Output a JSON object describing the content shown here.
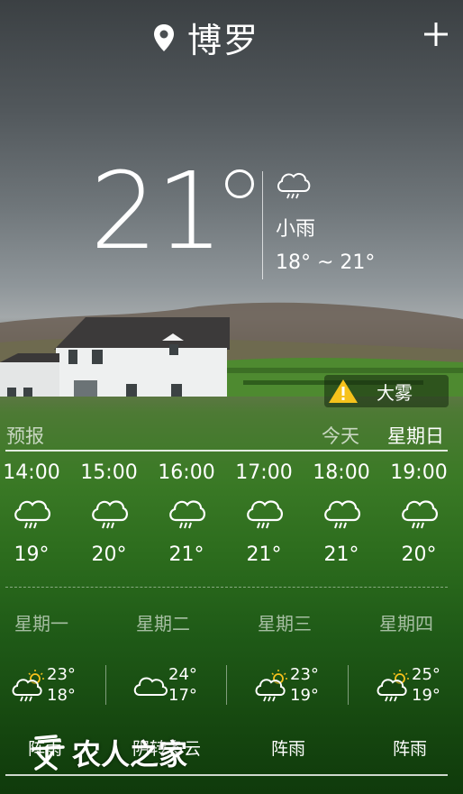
{
  "header": {
    "city": "博罗",
    "location_icon": "location-pin-icon",
    "add_icon": "plus-icon"
  },
  "current": {
    "temperature": "21",
    "condition": "小雨",
    "range": "18° ~ 21°",
    "icon": "light-rain-icon"
  },
  "alert": {
    "icon": "warning-icon",
    "label": "大雾"
  },
  "forecast": {
    "label": "预报",
    "tabs": [
      {
        "label": "今天",
        "active": false
      },
      {
        "label": "星期日",
        "active": true
      }
    ]
  },
  "hourly": [
    {
      "time": "14:00",
      "temp": "19°",
      "icon": "rain-icon"
    },
    {
      "time": "15:00",
      "temp": "20°",
      "icon": "rain-icon"
    },
    {
      "time": "16:00",
      "temp": "21°",
      "icon": "rain-icon"
    },
    {
      "time": "17:00",
      "temp": "21°",
      "icon": "rain-icon"
    },
    {
      "time": "18:00",
      "temp": "21°",
      "icon": "rain-icon"
    },
    {
      "time": "19:00",
      "temp": "20°",
      "icon": "rain-icon"
    }
  ],
  "daily": [
    {
      "day": "星期一",
      "high": "23°",
      "low": "18°",
      "condition": "阵雨",
      "icon": "shower-icon"
    },
    {
      "day": "星期二",
      "high": "24°",
      "low": "17°",
      "condition": "阴转多云",
      "icon": "cloudy-icon"
    },
    {
      "day": "星期三",
      "high": "23°",
      "low": "19°",
      "condition": "阵雨",
      "icon": "shower-icon"
    },
    {
      "day": "星期四",
      "high": "25°",
      "low": "19°",
      "condition": "阵雨",
      "icon": "shower-icon"
    }
  ],
  "watermark": {
    "text": "农人之家",
    "icon": "nongren-logo-icon"
  },
  "colors": {
    "warning": "#f6c21b",
    "sky_dark": "#3b4043",
    "grass": "#2c6c1d"
  }
}
